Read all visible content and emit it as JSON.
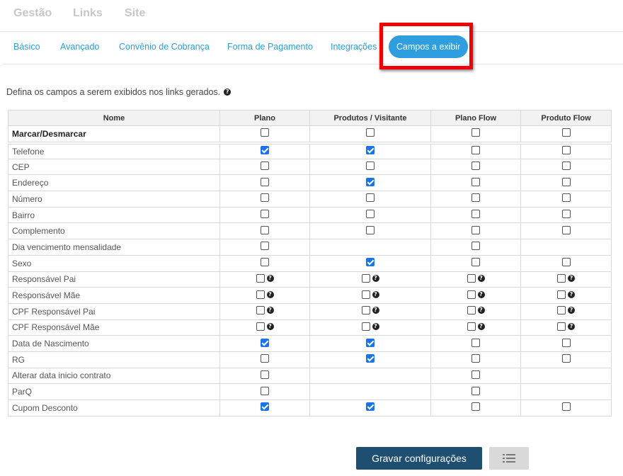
{
  "topnav": [
    "Gestão",
    "Links",
    "Site"
  ],
  "tabs": [
    "Básico",
    "Avançado",
    "Convênio de Cobrança",
    "Forma de Pagamento",
    "Integrações",
    "Campos a exibir"
  ],
  "active_tab": "Campos a exibir",
  "description": "Defina os campos a serem exibidos nos links gerados.",
  "columns": [
    "Nome",
    "Plano",
    "Produtos / Visitante",
    "Plano Flow",
    "Produto Flow"
  ],
  "toggle_row": {
    "name": "Marcar/Desmarcar",
    "cells": [
      false,
      false,
      false,
      false
    ]
  },
  "rows": [
    {
      "name": "Telefone",
      "cells": [
        true,
        true,
        false,
        false
      ]
    },
    {
      "name": "CEP",
      "cells": [
        false,
        false,
        false,
        false
      ]
    },
    {
      "name": "Endereço",
      "cells": [
        false,
        true,
        false,
        false
      ]
    },
    {
      "name": "Número",
      "cells": [
        false,
        false,
        false,
        false
      ]
    },
    {
      "name": "Bairro",
      "cells": [
        false,
        false,
        false,
        false
      ]
    },
    {
      "name": "Complemento",
      "cells": [
        false,
        false,
        false,
        false
      ]
    },
    {
      "name": "Dia vencimento mensalidade",
      "cells": [
        false,
        null,
        false,
        null
      ]
    },
    {
      "name": "Sexo",
      "cells": [
        false,
        true,
        false,
        false
      ]
    },
    {
      "name": "Responsável Pai",
      "cells": [
        false,
        false,
        false,
        false
      ],
      "help": true
    },
    {
      "name": "Responsável Mãe",
      "cells": [
        false,
        false,
        false,
        false
      ],
      "help": true
    },
    {
      "name": "CPF Responsável Pai",
      "cells": [
        false,
        false,
        false,
        false
      ],
      "help": true
    },
    {
      "name": "CPF Responsável Mãe",
      "cells": [
        false,
        false,
        false,
        false
      ],
      "help": true
    },
    {
      "name": "Data de Nascimento",
      "cells": [
        true,
        true,
        false,
        false
      ]
    },
    {
      "name": "RG",
      "cells": [
        false,
        true,
        false,
        false
      ]
    },
    {
      "name": "Alterar data inicio contrato",
      "cells": [
        false,
        null,
        false,
        null
      ]
    },
    {
      "name": "ParQ",
      "cells": [
        false,
        null,
        false,
        null
      ]
    },
    {
      "name": "Cupom Desconto",
      "cells": [
        true,
        true,
        false,
        false
      ]
    }
  ],
  "buttons": {
    "save": "Gravar configurações",
    "list_icon": "list-icon"
  },
  "colors": {
    "accent": "#2f9edf",
    "primary_button": "#1e4f70",
    "highlight": "#ee0000",
    "checked": "#1a73e8"
  }
}
